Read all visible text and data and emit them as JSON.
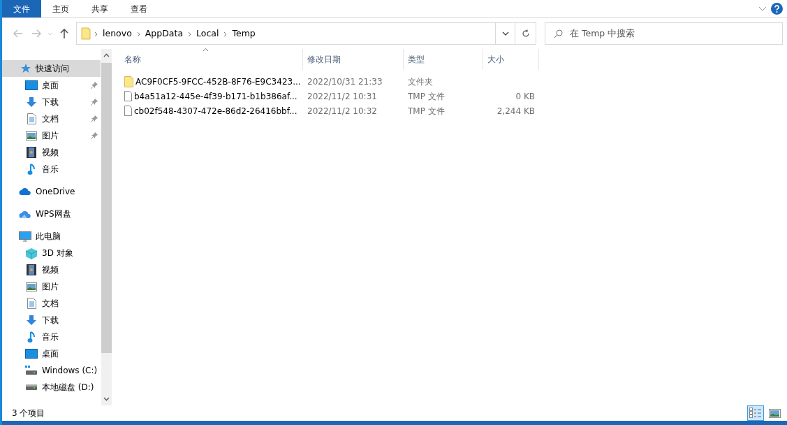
{
  "ribbon_tabs": [
    {
      "label": "文件",
      "selected": true
    },
    {
      "label": "主页",
      "selected": false
    },
    {
      "label": "共享",
      "selected": false
    },
    {
      "label": "查看",
      "selected": false
    }
  ],
  "breadcrumb": [
    "lenovo",
    "AppData",
    "Local",
    "Temp"
  ],
  "search": {
    "placeholder": "在 Temp 中搜索"
  },
  "sidebar": {
    "items": [
      {
        "label": "快速访问",
        "kind": "star",
        "selected": true,
        "children": [
          {
            "label": "桌面",
            "kind": "desktop",
            "pinned": true
          },
          {
            "label": "下载",
            "kind": "download",
            "pinned": true
          },
          {
            "label": "文档",
            "kind": "document",
            "pinned": true
          },
          {
            "label": "图片",
            "kind": "picture",
            "pinned": true
          },
          {
            "label": "视频",
            "kind": "video",
            "pinned": false
          },
          {
            "label": "音乐",
            "kind": "music",
            "pinned": false
          }
        ]
      },
      {
        "label": "OneDrive",
        "kind": "cloud",
        "selected": false
      },
      {
        "label": "WPS网盘",
        "kind": "cloud2",
        "selected": false
      },
      {
        "label": "此电脑",
        "kind": "pc",
        "selected": false,
        "children": [
          {
            "label": "3D 对象",
            "kind": "cube",
            "pinned": false
          },
          {
            "label": "视频",
            "kind": "video",
            "pinned": false
          },
          {
            "label": "图片",
            "kind": "picture",
            "pinned": false
          },
          {
            "label": "文档",
            "kind": "document",
            "pinned": false
          },
          {
            "label": "下载",
            "kind": "download",
            "pinned": false
          },
          {
            "label": "音乐",
            "kind": "music",
            "pinned": false
          },
          {
            "label": "桌面",
            "kind": "desktop",
            "pinned": false
          },
          {
            "label": "Windows (C:)",
            "kind": "windrive",
            "pinned": false
          },
          {
            "label": "本地磁盘 (D:)",
            "kind": "drive",
            "pinned": false
          }
        ]
      }
    ]
  },
  "table": {
    "columns": [
      {
        "label": "名称",
        "sorted": true
      },
      {
        "label": "修改日期",
        "sorted": false
      },
      {
        "label": "类型",
        "sorted": false
      },
      {
        "label": "大小",
        "sorted": false
      }
    ],
    "rows": [
      {
        "kind": "folder",
        "name": "AC9F0CF5-9FCC-452B-8F76-E9C3423...",
        "date": "2022/10/31 21:33",
        "type": "文件夹",
        "size": ""
      },
      {
        "kind": "file",
        "name": "b4a51a12-445e-4f39-b171-b1b386af...",
        "date": "2022/11/2 10:31",
        "type": "TMP 文件",
        "size": "0 KB"
      },
      {
        "kind": "file",
        "name": "cb02f548-4307-472e-86d2-26416bbf...",
        "date": "2022/11/2 10:32",
        "type": "TMP 文件",
        "size": "2,244 KB"
      }
    ]
  },
  "status_bar": {
    "text": "3 个项目",
    "views": [
      {
        "kind": "details",
        "selected": true
      },
      {
        "kind": "large",
        "selected": false
      }
    ]
  }
}
